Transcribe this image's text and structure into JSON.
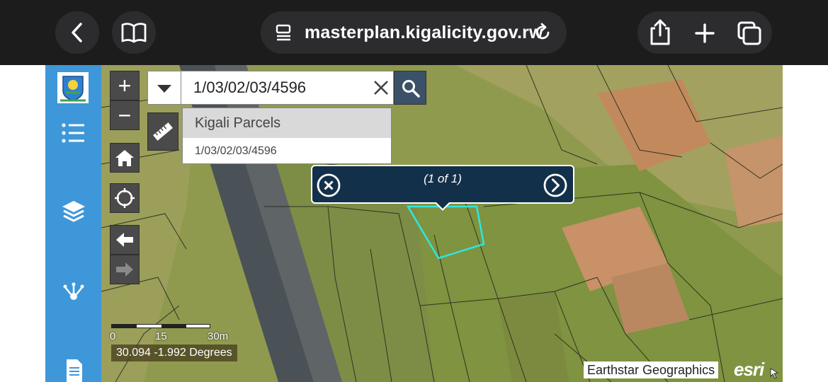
{
  "browser": {
    "url": "masterplan.kigalicity.gov.rw",
    "icons": {
      "back": "chevron-left-icon",
      "bookmarks": "book-icon",
      "reader": "reader-mode-icon",
      "reload": "reload-icon",
      "share": "share-icon",
      "new_tab": "plus-icon",
      "tabs": "tabs-icon"
    }
  },
  "sidebar": {
    "color": "#3e97d9",
    "items": [
      {
        "icon": "city-logo-icon"
      },
      {
        "icon": "list-icon"
      },
      {
        "icon": "layers-icon"
      },
      {
        "icon": "network-icon"
      },
      {
        "icon": "document-icon"
      }
    ]
  },
  "map": {
    "zoom_in": "+",
    "zoom_out": "−",
    "search": {
      "value": "1/03/02/03/4596",
      "suggestions": {
        "header": "Kigali Parcels",
        "items": [
          "1/03/02/03/4596"
        ]
      }
    },
    "popup": {
      "count": "(1 of 1)",
      "close_icon": "close-circle-icon",
      "next_icon": "next-circle-icon"
    },
    "scalebar": {
      "labels": [
        "0",
        "15",
        "30m"
      ]
    },
    "coordinates": "30.094 -1.992 Degrees",
    "attribution": "Earthstar Geographics",
    "logo": "esri",
    "parcel_highlight_color": "#2ee6e0"
  }
}
